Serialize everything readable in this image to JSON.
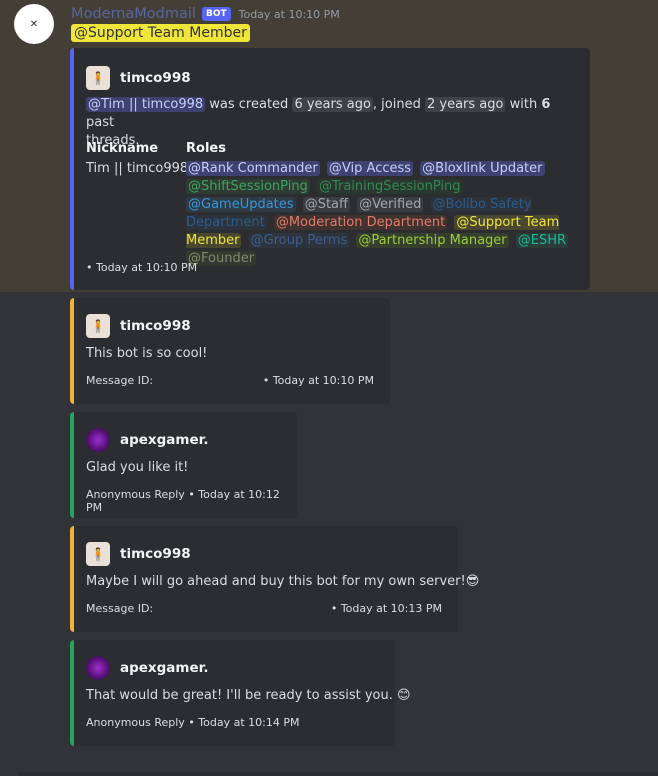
{
  "message": {
    "bot_name": "ModernaModmail",
    "bot_tag": "BOT",
    "timestamp": "Today at 10:10 PM",
    "mention": "@Support Team Member"
  },
  "info_embed": {
    "author": "timco998",
    "mention_user": "@Tim || timco998",
    "text_created": " was created ",
    "created_ago": "6 years ago",
    "text_joined": ", joined ",
    "joined_ago": "2 years ago",
    "text_with": " with ",
    "threads_count": "6",
    "text_past": " past",
    "text_threads": "threads.",
    "nickname_label": "Nickname",
    "nickname_value": "Tim || timco998",
    "roles_label": "Roles",
    "roles": [
      {
        "name": "@Rank Commander",
        "color": "#c9cdfb",
        "bg": "#3d4270"
      },
      {
        "name": "@Vip Access",
        "color": "#c9cdfb",
        "bg": "#3d4270"
      },
      {
        "name": "@Bloxlink Updater",
        "color": "#c9cdfb",
        "bg": "#3d4270"
      },
      {
        "name": "@ShiftSessionPing",
        "color": "#3ba55d",
        "bg": "#2e3c33"
      },
      {
        "name": "@TrainingSessionPing",
        "color": "#2f8a4f",
        "bg": "#2c3631"
      },
      {
        "name": "@GameUpdates",
        "color": "#3498db",
        "bg": "#2f3a47"
      },
      {
        "name": "@Staff",
        "color": "#a3a6aa",
        "bg": "#3a3c40"
      },
      {
        "name": "@Verified",
        "color": "#a3a6aa",
        "bg": "#3a3c40"
      },
      {
        "name": "@Bolibo Safety Department",
        "color": "#2a5d8c",
        "bg": "#2c333d"
      },
      {
        "name": "@Moderation Department",
        "color": "#e07a6a",
        "bg": "#40322f"
      },
      {
        "name": "@Support Team Member",
        "color": "#f0e63a",
        "bg": "#4a4630"
      },
      {
        "name": "@Group Perms",
        "color": "#3a5f8f",
        "bg": "#2e343e"
      },
      {
        "name": "@Partnership Manager",
        "color": "#9ad13a",
        "bg": "#363e2e"
      },
      {
        "name": "@ESHR",
        "color": "#1abc9c",
        "bg": "#2b3c39"
      },
      {
        "name": "@Founder",
        "color": "#7d8a6a",
        "bg": "#35382f"
      }
    ],
    "footer": "• Today at 10:10 PM"
  },
  "embeds": [
    {
      "author": "timco998",
      "body": "This bot is so cool!",
      "footer_left": "Message ID:",
      "footer_right": "• Today at 10:10 PM",
      "accent": "#f0b232"
    },
    {
      "author": "apexgamer.",
      "body": "Glad you like it!",
      "footer_left": "Anonymous Reply • Today at 10:12 PM",
      "footer_right": "",
      "accent": "#23a55a"
    },
    {
      "author": "timco998",
      "body": "Maybe I will go ahead and buy this bot for my own server!😎",
      "footer_left": "Message ID:",
      "footer_right": "• Today at 10:13 PM",
      "accent": "#f0b232"
    },
    {
      "author": "apexgamer.",
      "body": "That would be great! I'll be ready to assist you. 😊",
      "footer_left": "Anonymous Reply • Today at 10:14 PM",
      "footer_right": "",
      "accent": "#23a55a"
    }
  ]
}
